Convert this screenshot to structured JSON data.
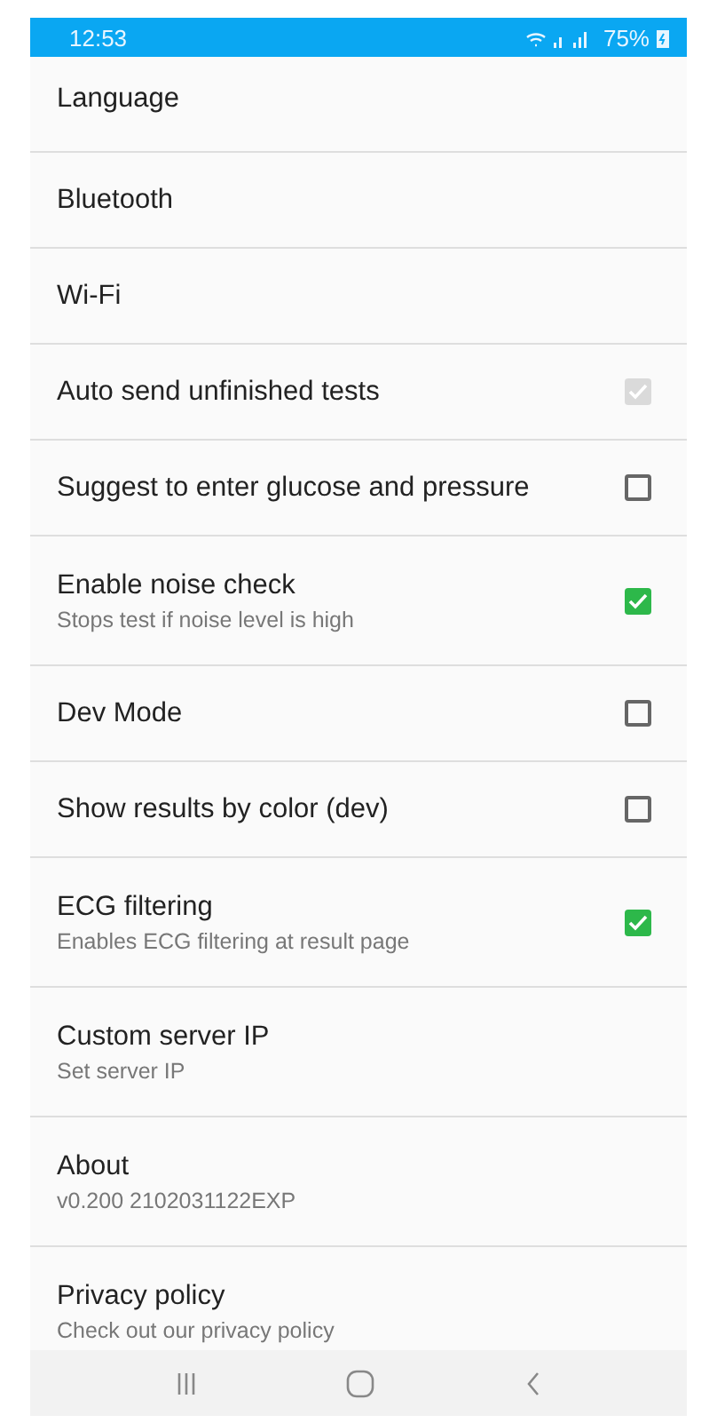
{
  "status_bar": {
    "time": "12:53",
    "battery": "75%"
  },
  "settings": [
    {
      "kind": "link",
      "title": "Language"
    },
    {
      "kind": "link",
      "title": "Bluetooth"
    },
    {
      "kind": "link",
      "title": "Wi-Fi"
    },
    {
      "kind": "checkbox",
      "title": "Auto send unfinished tests",
      "checked": true,
      "disabled": true
    },
    {
      "kind": "checkbox",
      "title": "Suggest to enter glucose and pressure",
      "checked": false,
      "disabled": false
    },
    {
      "kind": "checkbox",
      "title": "Enable noise check",
      "subtitle": "Stops test if noise level is high",
      "checked": true,
      "disabled": false
    },
    {
      "kind": "checkbox",
      "title": "Dev Mode",
      "checked": false,
      "disabled": false
    },
    {
      "kind": "checkbox",
      "title": "Show results by color (dev)",
      "checked": false,
      "disabled": false
    },
    {
      "kind": "checkbox",
      "title": "ECG filtering",
      "subtitle": "Enables ECG filtering at result page",
      "checked": true,
      "disabled": false
    },
    {
      "kind": "link",
      "title": "Custom server IP",
      "subtitle": "Set server IP"
    },
    {
      "kind": "link",
      "title": "About",
      "subtitle": "v0.200 2102031122EXP"
    },
    {
      "kind": "link",
      "title": "Privacy policy",
      "subtitle": "Check out our privacy policy"
    }
  ]
}
